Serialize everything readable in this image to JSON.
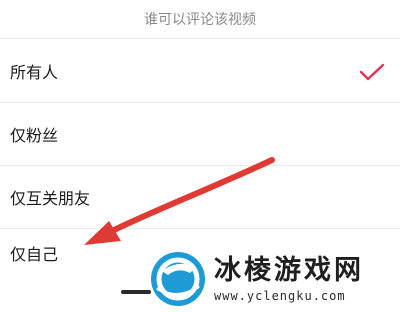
{
  "sheet": {
    "title": "谁可以评论该视频",
    "options": [
      {
        "label": "所有人",
        "selected": true,
        "icon": "check-icon"
      },
      {
        "label": "仅粉丝",
        "selected": false
      },
      {
        "label": "仅互关朋友",
        "selected": false
      },
      {
        "label": "仅自己",
        "selected": false
      }
    ]
  },
  "annotation": {
    "icon": "pointer-arrow",
    "color": "#e03a34"
  },
  "colors": {
    "accent": "#e6325a",
    "arrow": "#e03a34",
    "logo_blue": "#1e9bd7"
  },
  "watermark": {
    "brand": "冰棱游戏网",
    "url": "www.yclengku.com",
    "icon": "logo-icon"
  }
}
